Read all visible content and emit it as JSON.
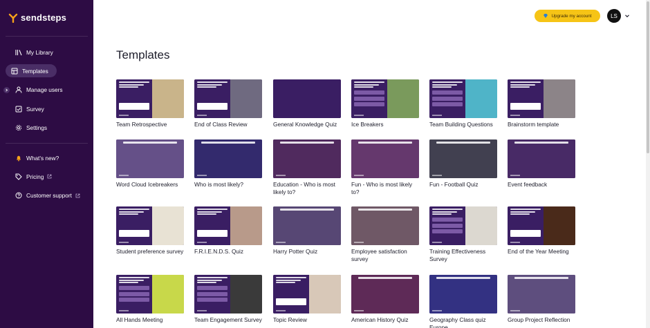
{
  "brand": {
    "name": "sendsteps"
  },
  "sidebar": {
    "primary": [
      {
        "label": "My Library",
        "icon": "library-icon",
        "active": false,
        "name": "sidebar-item-my-library"
      },
      {
        "label": "Templates",
        "icon": "templates-icon",
        "active": true,
        "name": "sidebar-item-templates"
      },
      {
        "label": "Manage users",
        "icon": "user-icon",
        "active": false,
        "name": "sidebar-item-manage-users"
      },
      {
        "label": "Survey",
        "icon": "checkbox-icon",
        "active": false,
        "name": "sidebar-item-survey"
      },
      {
        "label": "Settings",
        "icon": "gear-icon",
        "active": false,
        "name": "sidebar-item-settings"
      }
    ],
    "secondary": [
      {
        "label": "What's new?",
        "icon": "bell-icon",
        "name": "sidebar-item-whats-new"
      },
      {
        "label": "Pricing",
        "icon": "tag-icon",
        "name": "sidebar-item-pricing"
      },
      {
        "label": "Customer support",
        "icon": "help-icon",
        "name": "sidebar-item-customer-support"
      }
    ]
  },
  "header": {
    "upgrade_label": "Upgrade my account",
    "avatar_initials": "LS"
  },
  "page": {
    "title": "Templates"
  },
  "templates": [
    {
      "label": "Team Retrospective",
      "style": "split",
      "photo": "#c9b48a"
    },
    {
      "label": "End of Class Review",
      "style": "split",
      "photo": "#6f6a80"
    },
    {
      "label": "General Knowledge Quiz",
      "style": "plain",
      "photo": "#3a1e63"
    },
    {
      "label": "Ice Breakers",
      "style": "split-rows",
      "photo": "#7a9a5c"
    },
    {
      "label": "Team Building Questions",
      "style": "split-rows",
      "photo": "#4fb4c8"
    },
    {
      "label": "Brainstorm template",
      "style": "split",
      "photo": "#8c8488"
    },
    {
      "label": "Word Cloud Icebreakers",
      "style": "full",
      "photo": "#9a8fb6"
    },
    {
      "label": "Who is most likely?",
      "style": "full",
      "photo": "#2a3a7a"
    },
    {
      "label": "Education - Who is most likely to?",
      "style": "full",
      "photo": "#6a3a5a"
    },
    {
      "label": "Fun - Who is most likely to?",
      "style": "full",
      "photo": "#9a5a7a"
    },
    {
      "label": "Fun - Football Quiz",
      "style": "full",
      "photo": "#4a6a3a"
    },
    {
      "label": "Event feedback",
      "style": "full",
      "photo": "#5a3a6a"
    },
    {
      "label": "Student preference survey",
      "style": "split",
      "photo": "#e8e2d4"
    },
    {
      "label": "F.R.I.E.N.D.S. Quiz",
      "style": "split",
      "photo": "#b89a8a"
    },
    {
      "label": "Harry Potter Quiz",
      "style": "full",
      "photo": "#7a7a8a"
    },
    {
      "label": "Employee satisfaction survey",
      "style": "full",
      "photo": "#b0a06a"
    },
    {
      "label": "Training Effectiveness Survey",
      "style": "split-rows",
      "photo": "#dcd8d0"
    },
    {
      "label": "End of the Year Meeting",
      "style": "split",
      "photo": "#4a2a1a"
    },
    {
      "label": "All Hands Meeting",
      "style": "split-rows",
      "photo": "#c8d84a"
    },
    {
      "label": "Team Engagement Survey",
      "style": "split-rows",
      "photo": "#3a3a3a"
    },
    {
      "label": "Topic Review",
      "style": "split",
      "photo": "#d8c8b8"
    },
    {
      "label": "American History Quiz",
      "style": "full",
      "photo": "#8a3a4a"
    },
    {
      "label": "Geography Class quiz Europe",
      "style": "full",
      "photo": "#2a4aa8"
    },
    {
      "label": "Group Project Reflection",
      "style": "full",
      "photo": "#8a8aa0"
    }
  ]
}
